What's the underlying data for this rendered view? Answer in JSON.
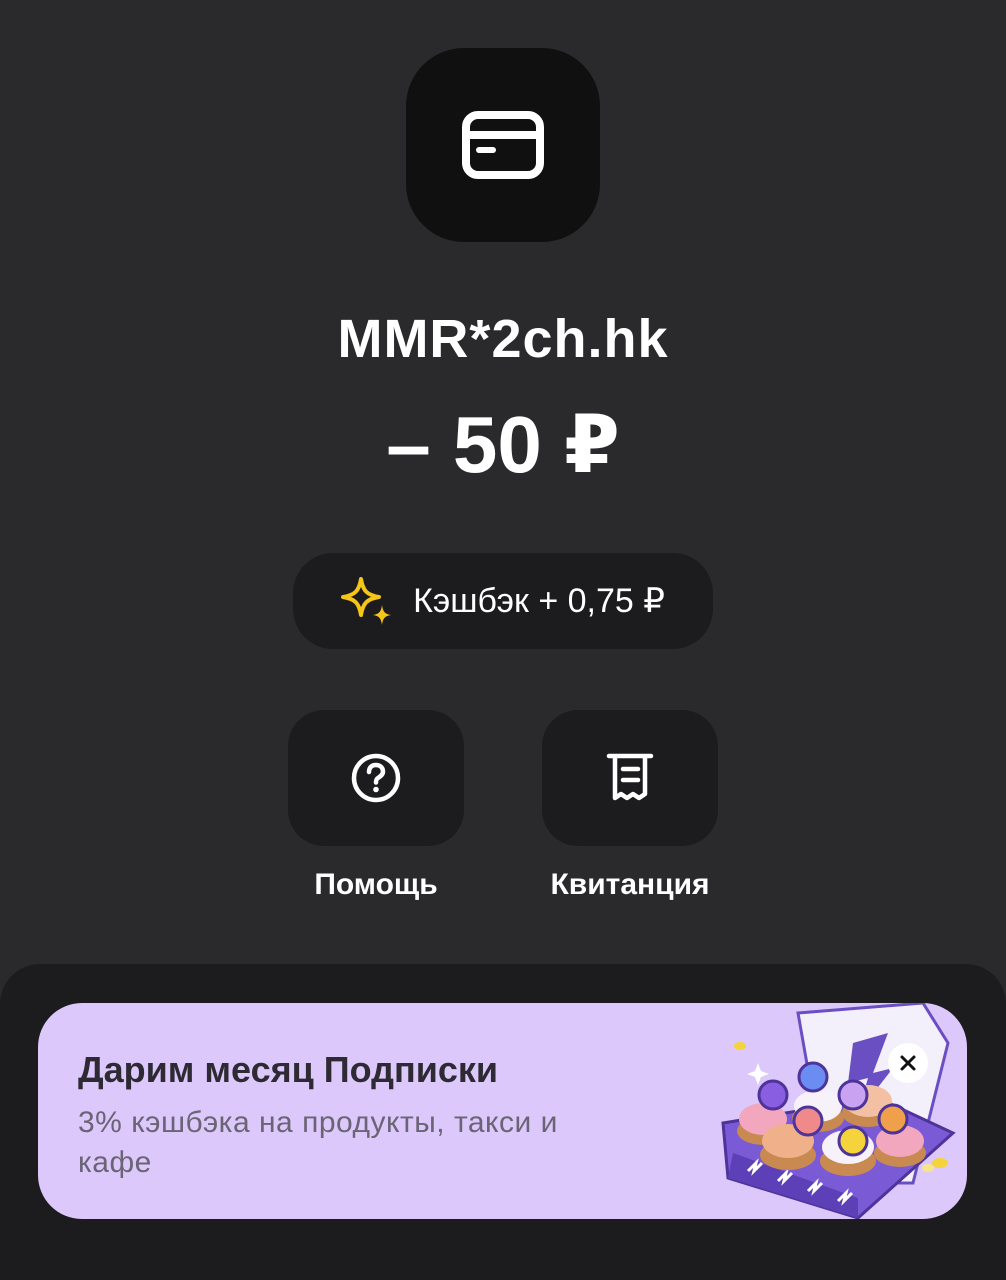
{
  "transaction": {
    "merchant_icon": "credit-card-icon",
    "merchant_name": "MMR*2ch.hk",
    "amount": "– 50 ₽"
  },
  "cashback": {
    "icon": "sparkles-icon",
    "label": "Кэшбэк + 0,75 ₽",
    "icon_color": "#f5c518"
  },
  "actions": [
    {
      "icon": "question-circle-icon",
      "label": "Помощь"
    },
    {
      "icon": "receipt-icon",
      "label": "Квитанция"
    }
  ],
  "promo": {
    "title": "Дарим месяц Подписки",
    "text": "3% кэшбэка на продукты, такси и кафе",
    "close_icon": "close-icon",
    "background": "#dcc8fb",
    "illustration": "cupcake-box-illustration"
  },
  "colors": {
    "background": "#2a2a2d",
    "surface": "#1c1c1e",
    "logo_background": "#101010"
  }
}
